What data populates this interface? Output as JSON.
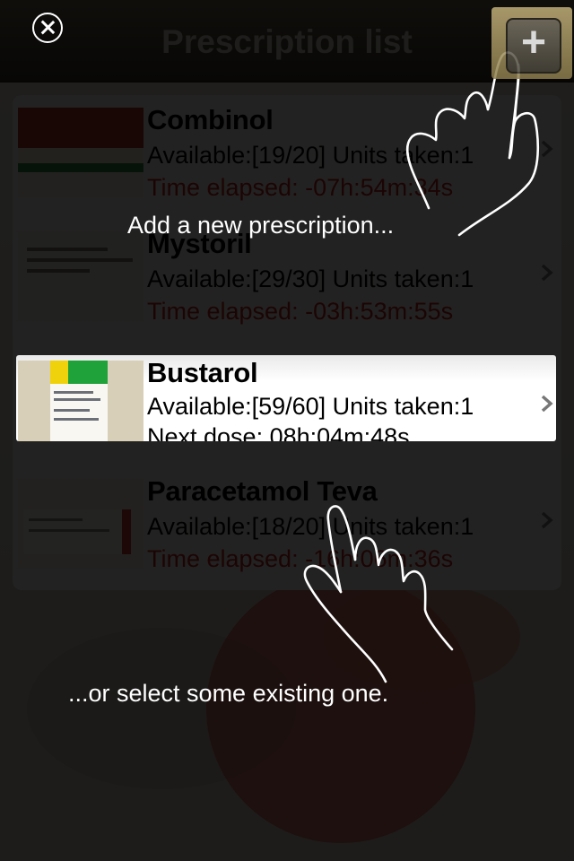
{
  "navbar": {
    "title": "Prescription list",
    "close_icon": "close-circle-icon",
    "add_label": "+"
  },
  "prescriptions": [
    {
      "name": "Combinol",
      "available": "Available:[19/20] Units taken:1",
      "status": "Time elapsed: -07h:54m:34s",
      "overdue": true
    },
    {
      "name": "Mystoril",
      "available": "Available:[29/30] Units taken:1",
      "status": "Time elapsed: -03h:53m:55s",
      "overdue": true
    },
    {
      "name": "Bustarol",
      "available": "Available:[59/60] Units taken:1",
      "status": "Next dose: 08h:04m:48s",
      "overdue": false
    },
    {
      "name": "Paracetamol Teva",
      "available": "Available:[18/20] Units taken:1",
      "status": "Time elapsed: -16h:06m:36s",
      "overdue": true
    }
  ],
  "tips": {
    "add": "Add a new prescription...",
    "select": "...or select some existing one."
  },
  "colors": {
    "overdue_text": "#c0241c",
    "navbar": "#4b4536",
    "accent_gold": "#c2b07a"
  }
}
